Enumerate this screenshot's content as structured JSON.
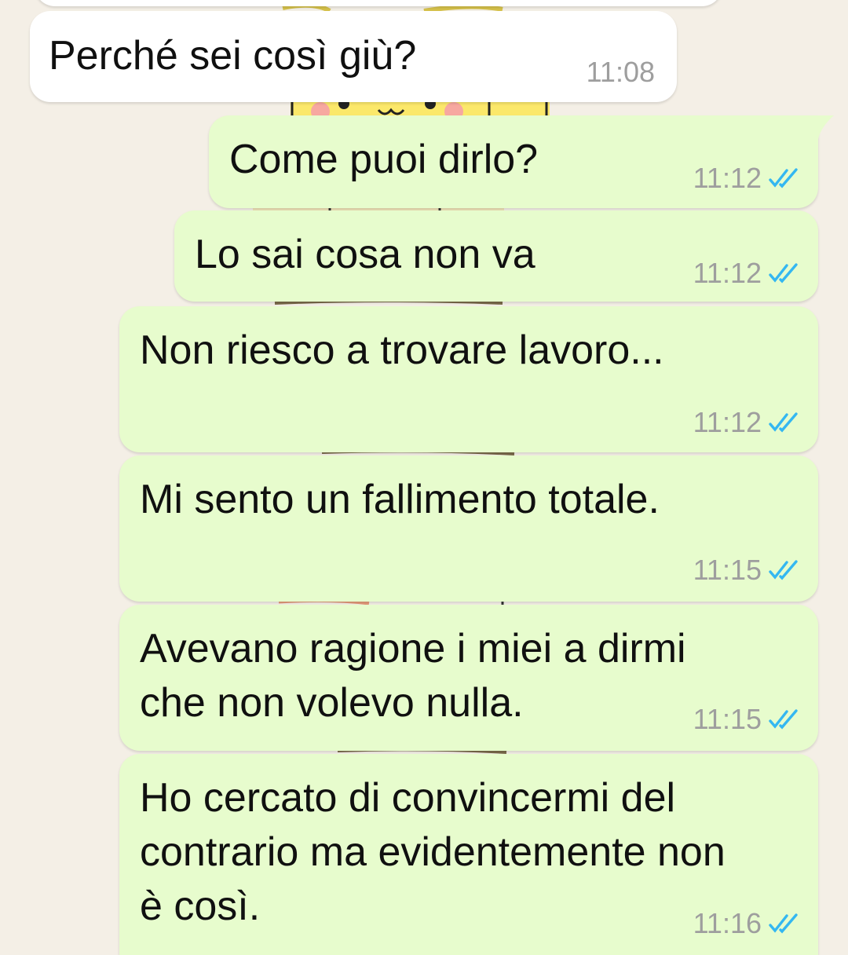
{
  "chat": {
    "incoming": [
      {
        "text": "Perché sei così giù?",
        "time": "11:08"
      }
    ],
    "outgoing": [
      {
        "lines": [
          "Come puoi dirlo?"
        ],
        "time": "11:12",
        "status": "read-double-tick-icon"
      },
      {
        "lines": [
          "Lo sai cosa non va"
        ],
        "time": "11:12",
        "status": "read-double-tick-icon"
      },
      {
        "lines": [
          "Non riesco a trovare lavoro..."
        ],
        "time": "11:12",
        "status": "read-double-tick-icon"
      },
      {
        "lines": [
          "Mi sento un fallimento totale."
        ],
        "time": "11:15",
        "status": "read-double-tick-icon"
      },
      {
        "lines": [
          "Avevano ragione i miei a dirmi",
          "che non volevo nulla."
        ],
        "time": "11:15",
        "status": "read-double-tick-icon"
      },
      {
        "lines": [
          "Ho cercato di convincermi del",
          "contrario ma evidentemente non",
          "è così."
        ],
        "time": "11:16",
        "status": "read-double-tick-icon"
      }
    ]
  },
  "colors": {
    "incoming_bubble": "#ffffff",
    "outgoing_bubble": "#e7fccd",
    "read_ticks": "#34b7f1",
    "timestamp": "#9e9e9e",
    "wallpaper": "#f4efe6"
  }
}
